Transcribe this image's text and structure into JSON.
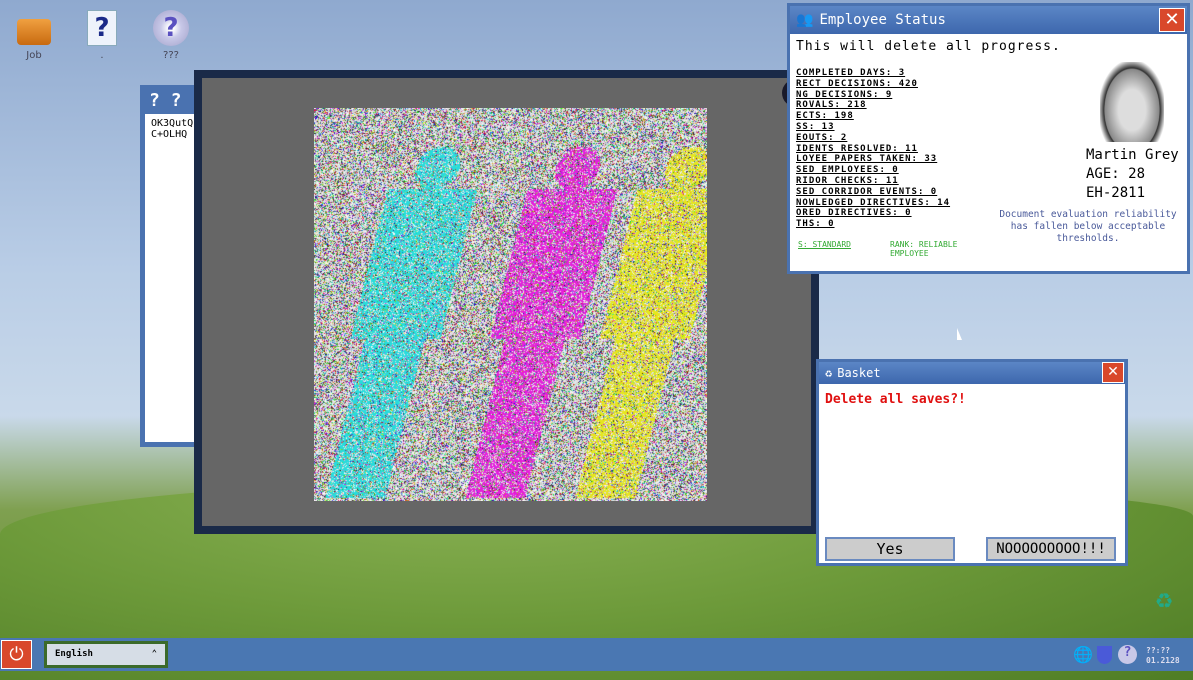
{
  "desktop": {
    "icons": [
      {
        "label": "Job",
        "icon": "briefcase-icon"
      },
      {
        "label": ".",
        "icon": "help-document-icon"
      },
      {
        "label": "???",
        "icon": "help-disc-icon"
      }
    ]
  },
  "bg_window": {
    "lines": [
      "OK3QutQ",
      "C+OLHQ"
    ]
  },
  "viewer": {
    "close": "✕"
  },
  "employee": {
    "title": "Employee Status",
    "warning": "This will delete all progress.",
    "stats": [
      "COMPLETED DAYS: 3",
      "RECT DECISIONS: 420",
      "NG DECISIONS: 9",
      "ROVALS: 218",
      "ECTS: 198",
      "SS: 13",
      "EOUTS: 2",
      "IDENTS RESOLVED: 11",
      "LOYEE PAPERS TAKEN: 33",
      "SED EMPLOYEES: 0",
      "RIDOR CHECKS: 11",
      "SED CORRIDOR EVENTS: 0",
      "NOWLEDGED DIRECTIVES: 14",
      "ORED DIRECTIVES: 0",
      "THS: 0"
    ],
    "status": "S: STANDARD",
    "rank": "RANK: RELIABLE EMPLOYEE",
    "name": "Martin Grey",
    "age": "AGE: 28",
    "id": "EH-2811",
    "note": "Document evaluation reliability has fallen below acceptable thresholds."
  },
  "basket": {
    "title": "Basket",
    "message": "Delete all saves?!",
    "yes": "Yes",
    "no": "NOOOOOOOOO!!!"
  },
  "taskbar": {
    "language": "English",
    "time": "??:??",
    "date": "01.2128"
  }
}
